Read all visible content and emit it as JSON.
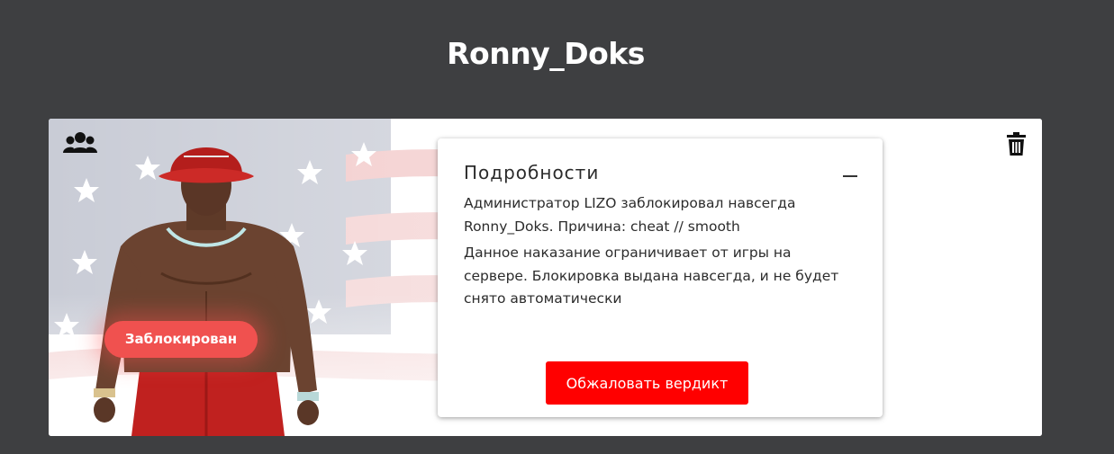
{
  "profile": {
    "username": "Ronny_Doks",
    "status_badge": "Заблокирован"
  },
  "icons": {
    "group": "users-group-icon",
    "delete": "trash-icon",
    "collapse": "minus-icon"
  },
  "details": {
    "title": "Подробности",
    "ban_message": "Администратор LIZO заблокировал навсегда Ronny_Doks. Причина: cheat // smooth",
    "ban_description": "Данное наказание ограничивает от игры на сервере. Блокировка выдана навсегда, и не будет снято автоматически",
    "appeal_button": "Обжаловать вердикт"
  },
  "colors": {
    "page_background": "#3e3f41",
    "status_badge": "#f0514f",
    "appeal_button": "#ff0000"
  }
}
